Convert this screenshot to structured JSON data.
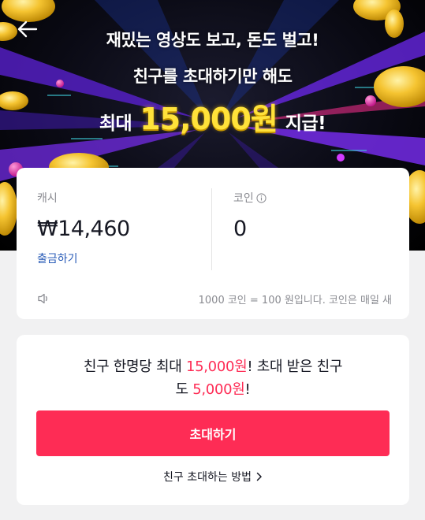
{
  "hero": {
    "line1": "재밌는 영상도 보고, 돈도 벌고!",
    "line2": "친구를 초대하기만 해도",
    "line3_prefix": "최대",
    "line3_amount": "15,000원",
    "line3_suffix": "지급!",
    "colors": {
      "amount": "#ffe23a",
      "background": "#000000"
    }
  },
  "nav": {
    "back_icon": "back-arrow-icon"
  },
  "balance": {
    "cash_label": "캐시",
    "cash_value": "₩14,460",
    "withdraw_label": "출금하기",
    "coin_label": "코인",
    "coin_info_icon": "info-icon",
    "coin_value": "0",
    "notice_icon": "speaker-icon",
    "notice_text": "1000 코인 = 100 원입니다. 코인은 매일 새"
  },
  "invite": {
    "text_part1": "친구 한명당 최대 ",
    "text_amount1": "15,000원",
    "text_part2": "! 초대 받은 친구",
    "text_part3": "도 ",
    "text_amount2": "5,000원",
    "text_part4": "!",
    "button_label": "초대하기",
    "howto_label": "친구 초대하는 방법",
    "howto_icon": "chevron-right-icon",
    "colors": {
      "accent": "#fe2c55",
      "link": "#2b5db8"
    }
  }
}
